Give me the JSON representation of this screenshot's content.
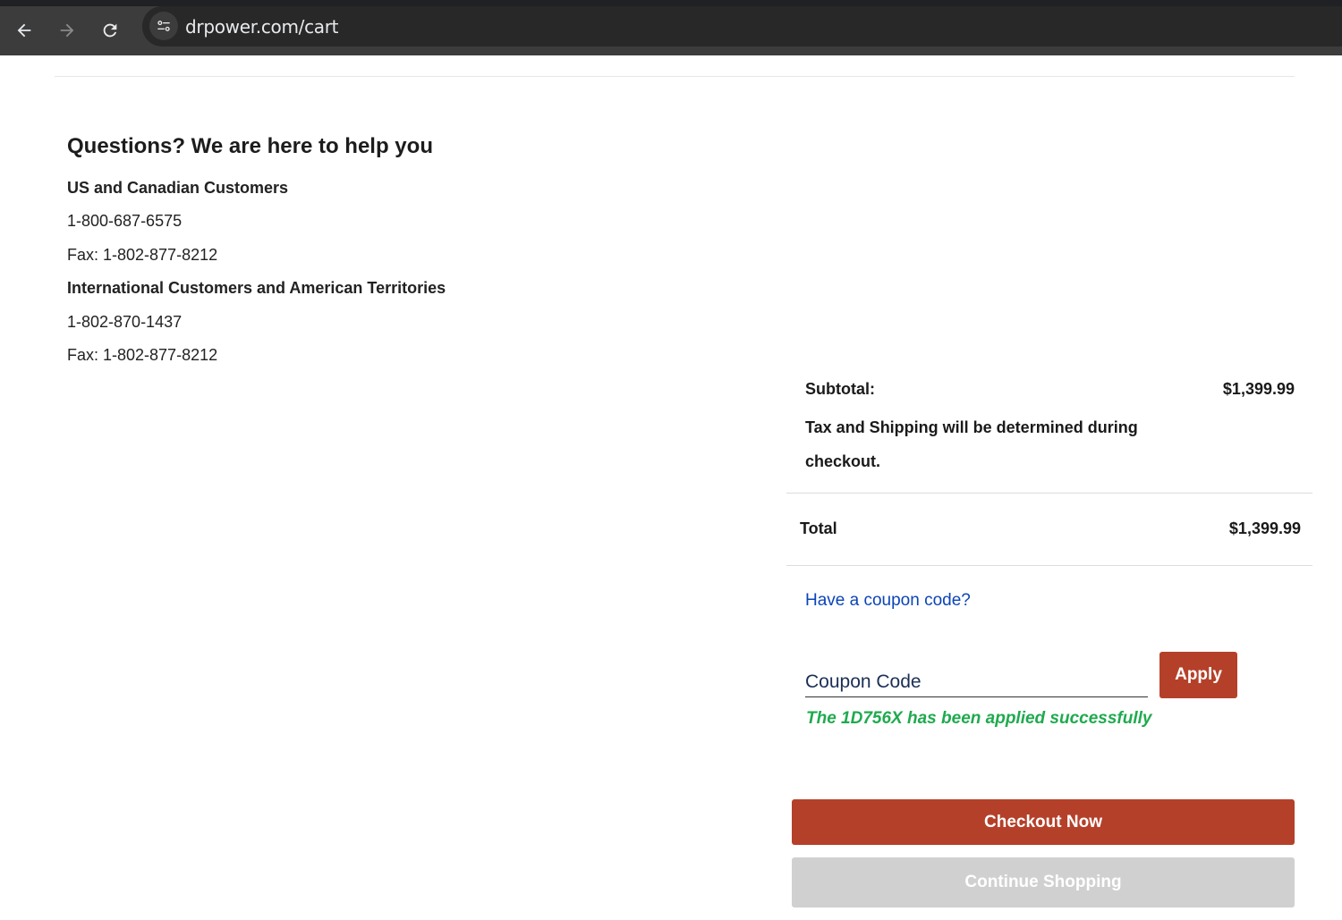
{
  "browser": {
    "url": "drpower.com/cart",
    "icons": [
      "back-arrow-icon",
      "forward-arrow-icon",
      "reload-icon",
      "site-info-icon"
    ]
  },
  "help": {
    "title": "Questions? We are here to help you",
    "us_heading": "US and Canadian Customers",
    "us_phone": "1-800-687-6575",
    "us_fax": "Fax: 1-802-877-8212",
    "intl_heading": "International Customers and American Territories",
    "intl_phone": "1-802-870-1437",
    "intl_fax": "Fax: 1-802-877-8212"
  },
  "summary": {
    "subtotal_label": "Subtotal:",
    "subtotal_value": "$1,399.99",
    "tax_note": "Tax and Shipping will be determined during checkout.",
    "total_label": "Total",
    "total_value": "$1,399.99"
  },
  "coupon": {
    "link_text": "Have a coupon code?",
    "placeholder": "Coupon Code",
    "value": "",
    "apply_label": "Apply",
    "success_message": "The 1D756X has been applied successfully"
  },
  "actions": {
    "checkout_label": "Checkout Now",
    "continue_label": "Continue Shopping"
  },
  "colors": {
    "brand_button": "#b5402a",
    "link": "#0b44b8",
    "success": "#1faa4f",
    "disabled_button": "#d0d0d0"
  }
}
